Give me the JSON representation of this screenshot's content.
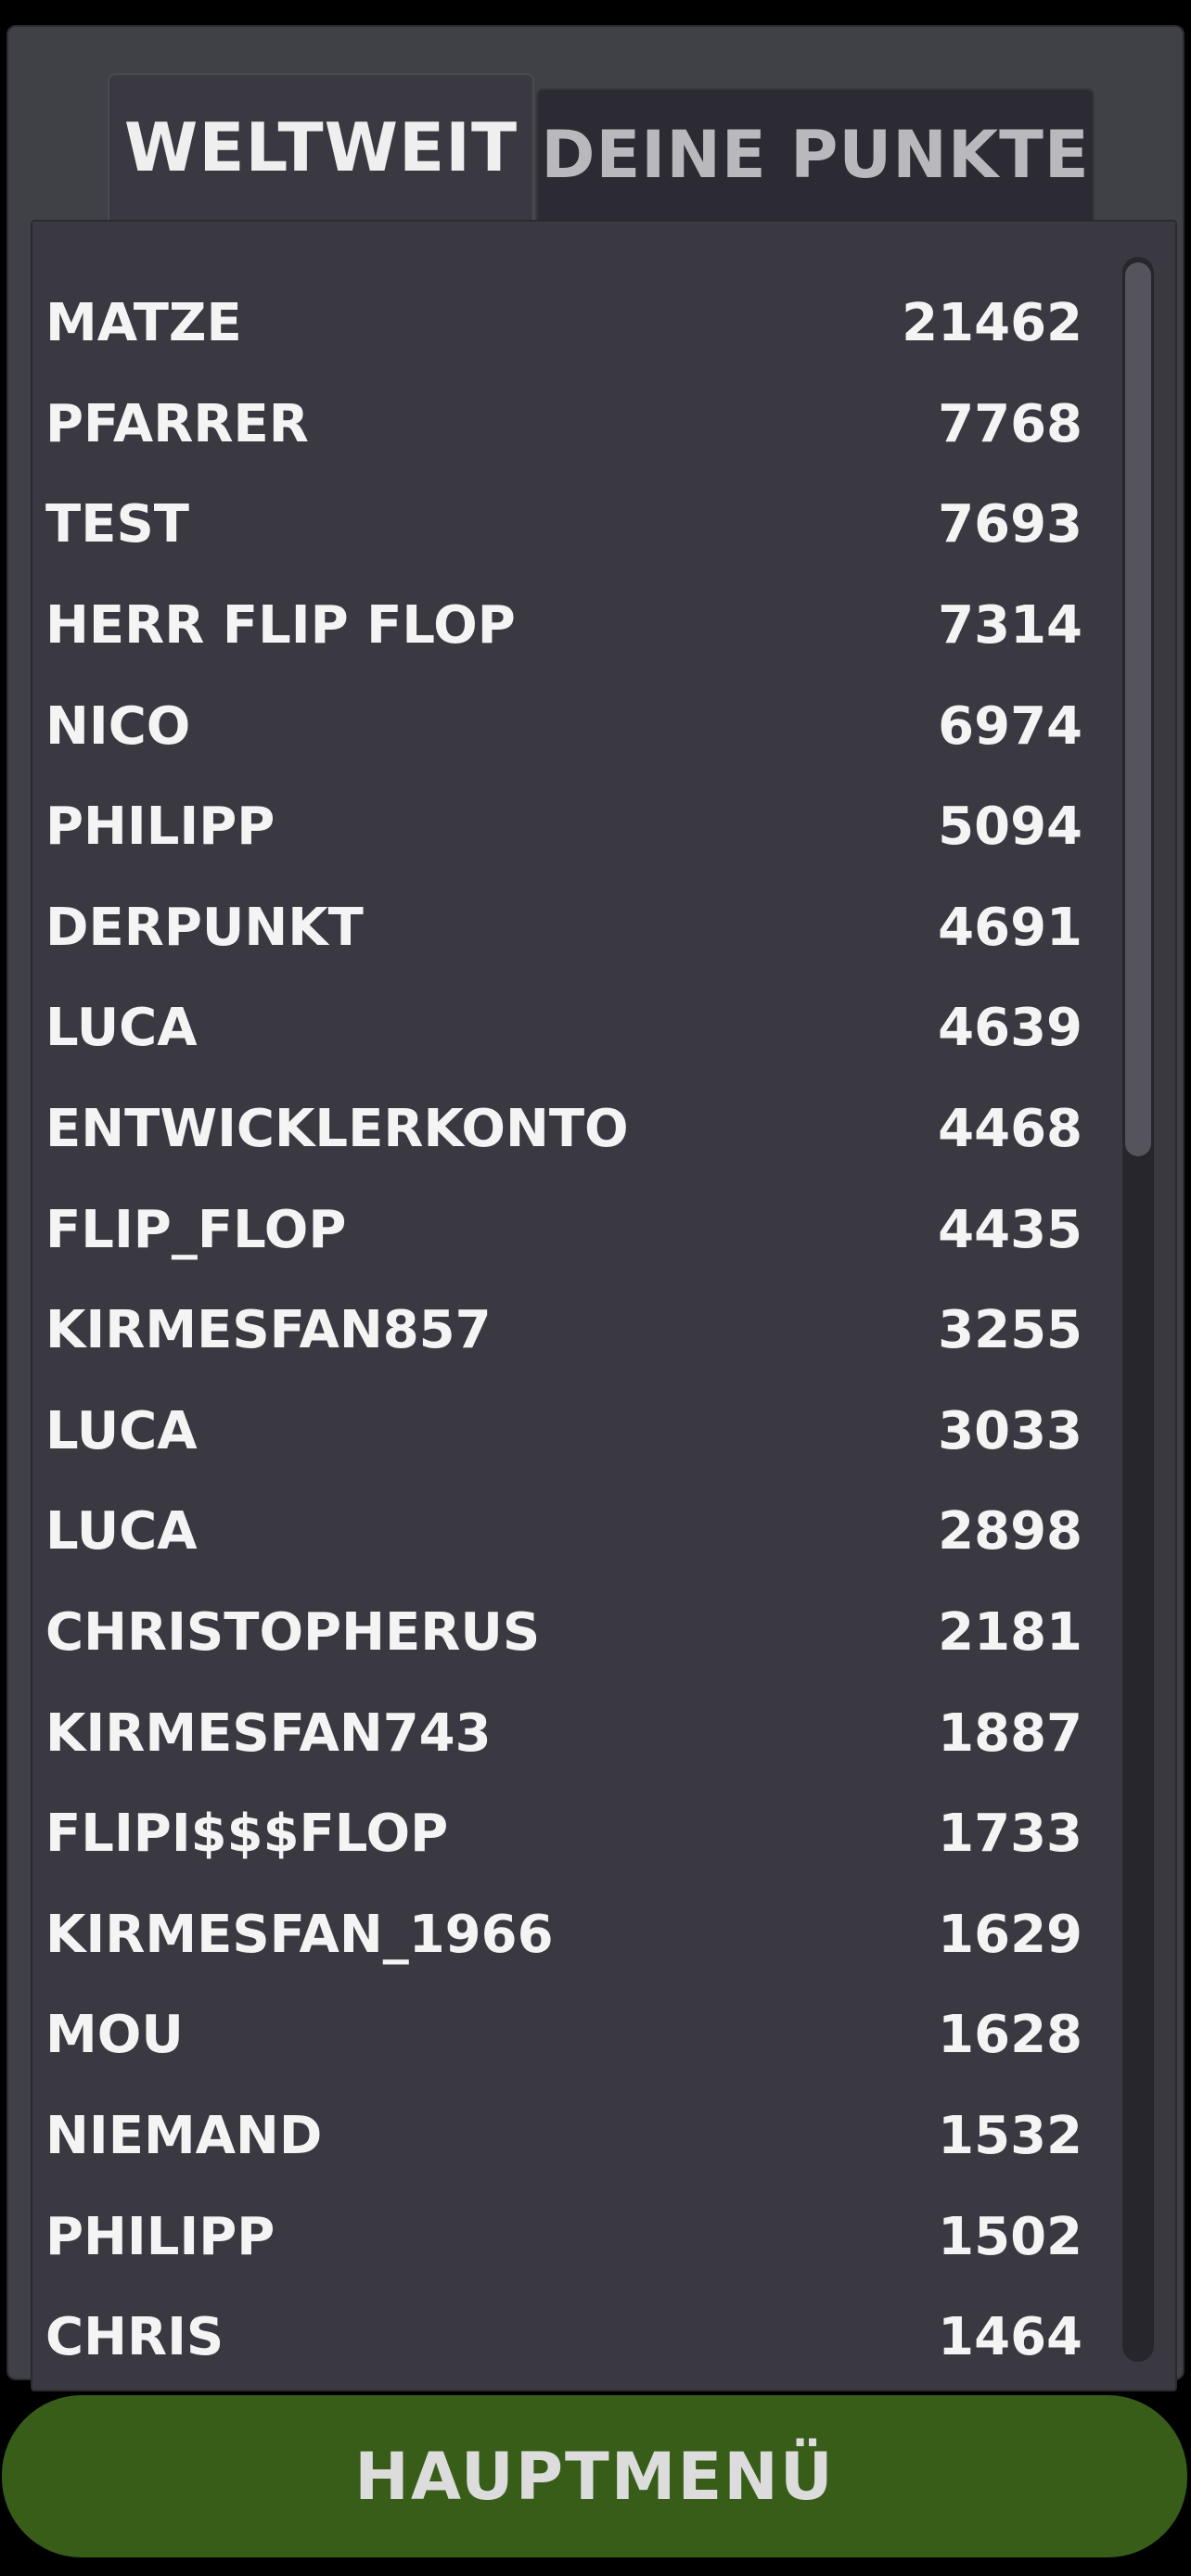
{
  "tabs": {
    "worldwide": "WELTWEIT",
    "own_points": "DEINE PUNKTE"
  },
  "leaderboard": [
    {
      "name": "MATZE",
      "score": "21462"
    },
    {
      "name": "PFARRER",
      "score": "7768"
    },
    {
      "name": "TEST",
      "score": "7693"
    },
    {
      "name": "HERR FLIP FLOP",
      "score": "7314"
    },
    {
      "name": "NICO",
      "score": "6974"
    },
    {
      "name": "PHILIPP",
      "score": "5094"
    },
    {
      "name": "DERPUNKT",
      "score": "4691"
    },
    {
      "name": "LUCA",
      "score": "4639"
    },
    {
      "name": "ENTWICKLERKONTO",
      "score": "4468"
    },
    {
      "name": "FLIP_FLOP",
      "score": "4435"
    },
    {
      "name": "KIRMESFAN857",
      "score": "3255"
    },
    {
      "name": "LUCA",
      "score": "3033"
    },
    {
      "name": "LUCA",
      "score": "2898"
    },
    {
      "name": "CHRISTOPHERUS",
      "score": "2181"
    },
    {
      "name": "KIRMESFAN743",
      "score": "1887"
    },
    {
      "name": "FLIPI$$$FLOP",
      "score": "1733"
    },
    {
      "name": "KIRMESFAN_1966",
      "score": "1629"
    },
    {
      "name": "MOU",
      "score": "1628"
    },
    {
      "name": "NIEMAND",
      "score": "1532"
    },
    {
      "name": "PHILIPP",
      "score": "1502"
    },
    {
      "name": "CHRIS",
      "score": "1464"
    }
  ],
  "footer": {
    "main_menu_label": "HAUPTMENÜ"
  },
  "colors": {
    "panel_bg": "#404047",
    "list_bg": "#3a3941",
    "button_bg": "#385d19",
    "text": "#f4f4f4"
  }
}
